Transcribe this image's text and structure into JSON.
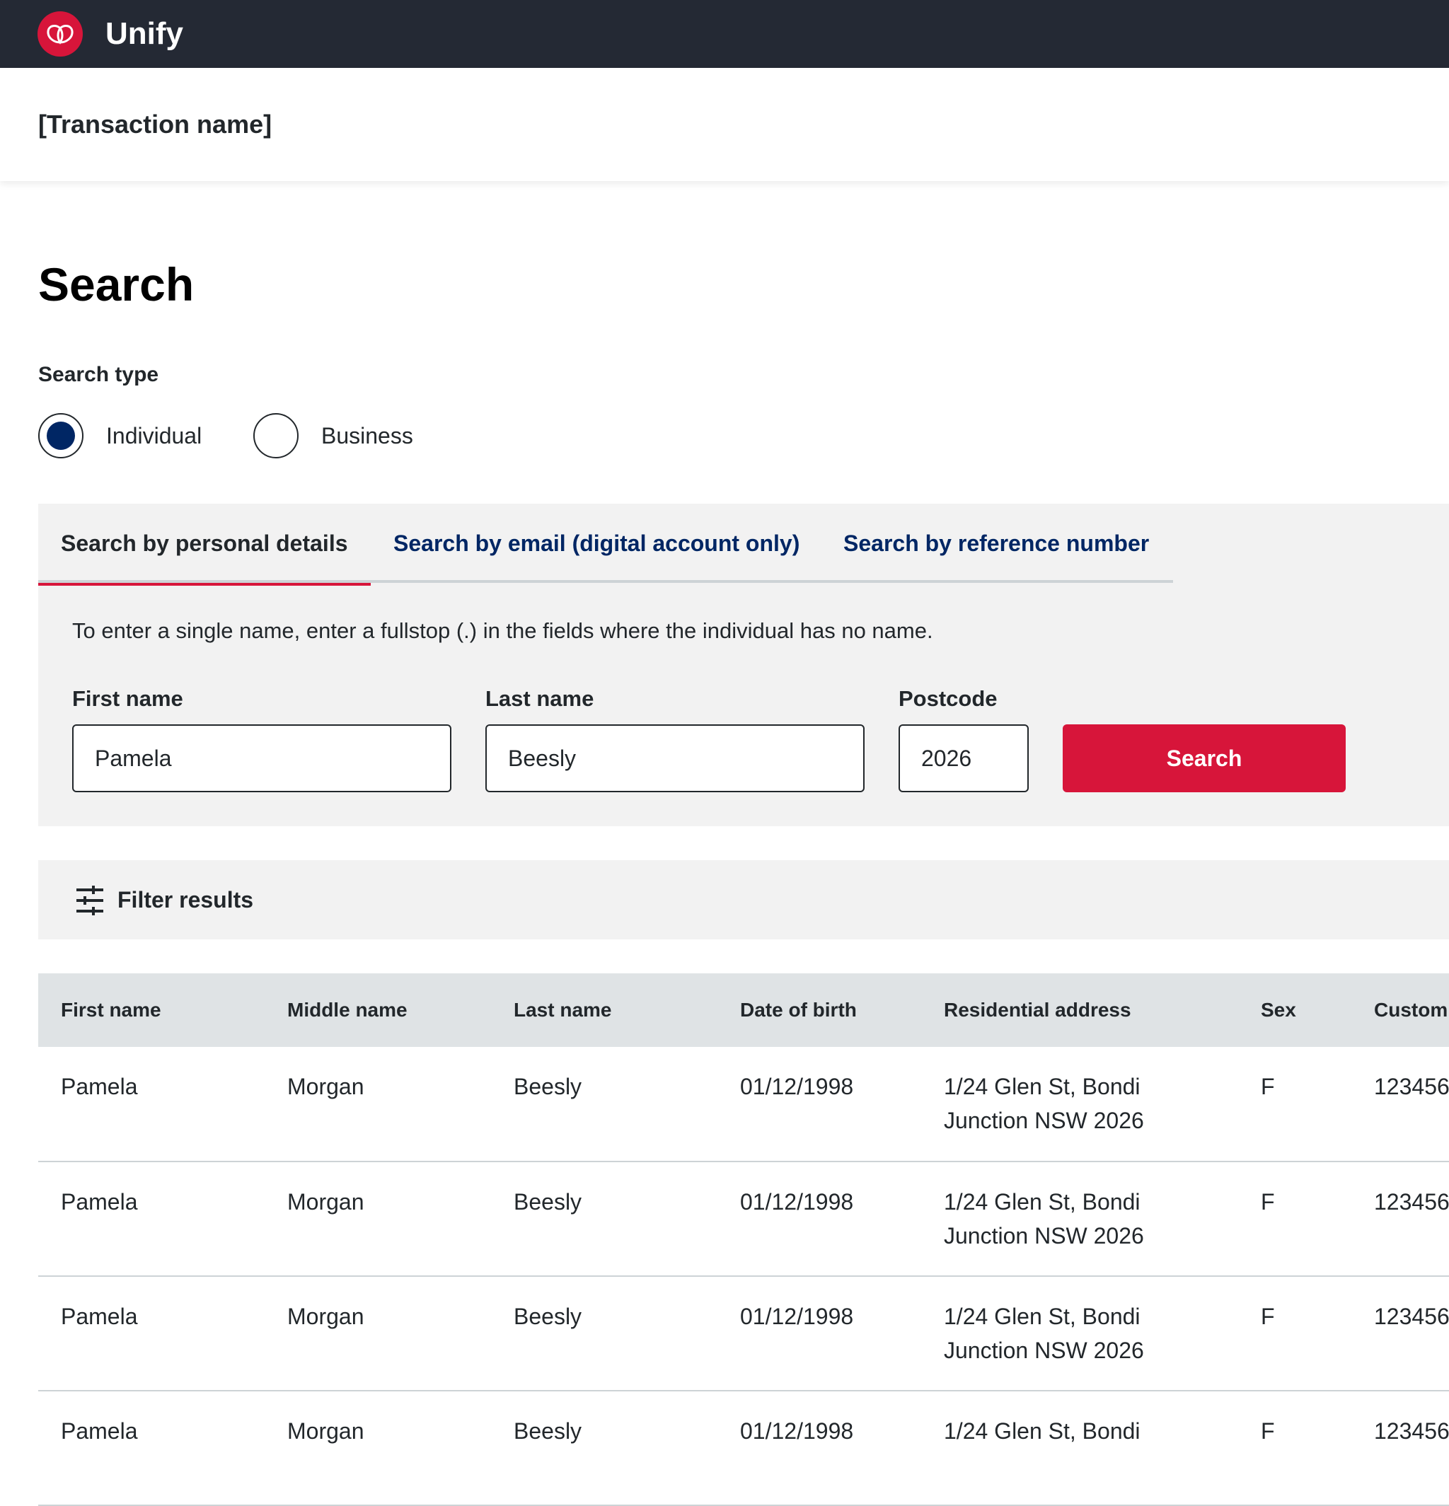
{
  "app": {
    "name": "Unify",
    "logo_icon": "waratah-logo-icon",
    "brand_color": "#d7153a",
    "topbar_color": "#242934"
  },
  "transaction": {
    "name": "[Transaction name]"
  },
  "page": {
    "title": "Search"
  },
  "search_type": {
    "label": "Search type",
    "options": [
      {
        "label": "Individual",
        "selected": true
      },
      {
        "label": "Business",
        "selected": false
      }
    ]
  },
  "tabs": [
    {
      "label": "Search by personal details",
      "active": true
    },
    {
      "label": "Search by email (digital account only)",
      "active": false
    },
    {
      "label": "Search by reference number",
      "active": false
    }
  ],
  "form": {
    "helper": "To enter a single name, enter a fullstop (.) in the fields where the individual has no name.",
    "first_name": {
      "label": "First name",
      "value": "Pamela"
    },
    "last_name": {
      "label": "Last name",
      "value": "Beesly"
    },
    "postcode": {
      "label": "Postcode",
      "value": "2026"
    },
    "search_button": "Search"
  },
  "filter": {
    "label": "Filter results",
    "icon": "sliders-icon"
  },
  "table": {
    "headers": [
      "First name",
      "Middle name",
      "Last name",
      "Date of birth",
      "Residential address",
      "Sex",
      "Custom"
    ],
    "rows": [
      [
        "Pamela",
        "Morgan",
        "Beesly",
        "01/12/1998",
        "1/24 Glen St, Bondi Junction NSW 2026",
        "F",
        "123456"
      ],
      [
        "Pamela",
        "Morgan",
        "Beesly",
        "01/12/1998",
        "1/24 Glen St, Bondi Junction NSW 2026",
        "F",
        "123456"
      ],
      [
        "Pamela",
        "Morgan",
        "Beesly",
        "01/12/1998",
        "1/24 Glen St, Bondi Junction NSW 2026",
        "F",
        "123456"
      ],
      [
        "Pamela",
        "Morgan",
        "Beesly",
        "01/12/1998",
        "1/24 Glen St, Bondi",
        "F",
        "123456"
      ]
    ]
  }
}
